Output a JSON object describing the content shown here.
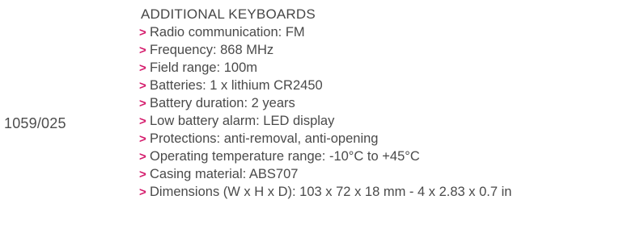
{
  "product_code": "1059/025",
  "section_title": "ADDITIONAL KEYBOARDS",
  "bullet_color": "#d4186a",
  "bullet_icon": "chevron-right-icon",
  "specs": [
    "Radio communication: FM",
    "Frequency: 868 MHz",
    "Field range: 100m",
    "Batteries: 1 x lithium CR2450",
    "Battery duration: 2 years",
    "Low battery alarm: LED display",
    "Protections: anti-removal, anti-opening",
    "Operating temperature range: -10°C to +45°C",
    "Casing material: ABS707",
    "Dimensions (W x H x D): 103 x 72 x 18 mm - 4 x 2.83 x 0.7 in"
  ]
}
